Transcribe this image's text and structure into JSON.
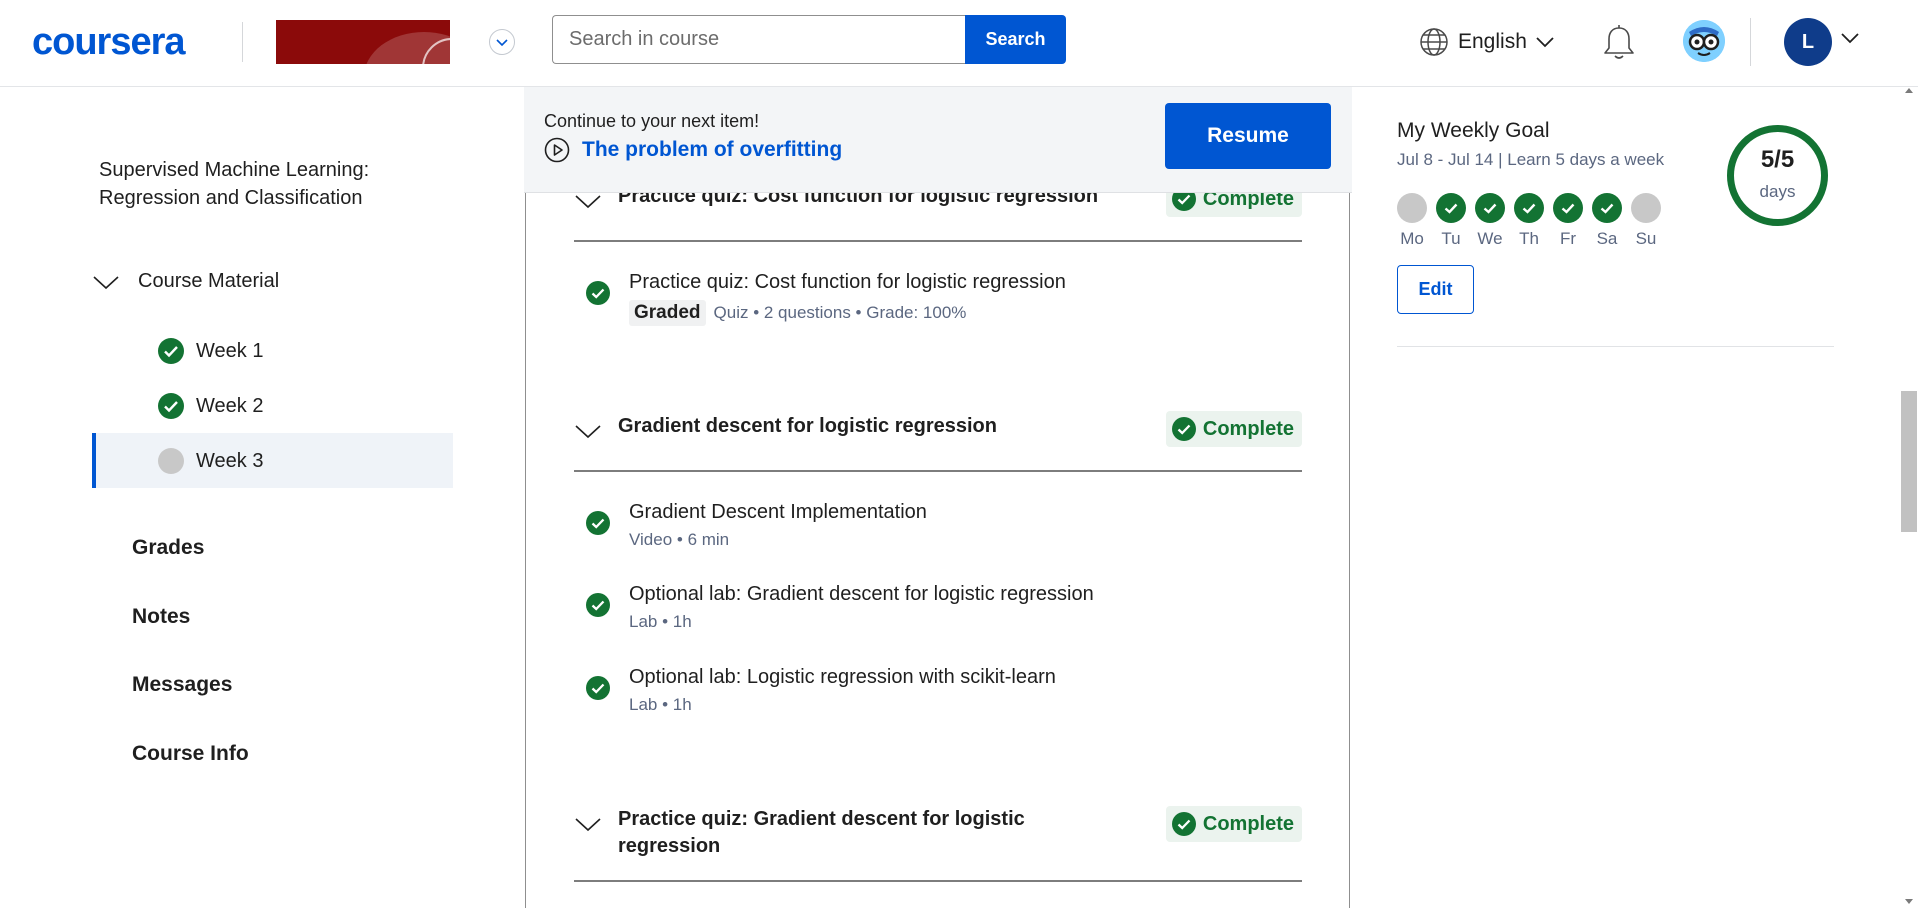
{
  "header": {
    "logo_text": "coursera",
    "search_placeholder": "Search in course",
    "search_button": "Search",
    "language": "English",
    "user_initial": "L"
  },
  "sidebar": {
    "course_title": "Supervised Machine Learning: Regression and Classification",
    "material_label": "Course Material",
    "weeks": [
      {
        "label": "Week 1",
        "status": "complete"
      },
      {
        "label": "Week 2",
        "status": "complete"
      },
      {
        "label": "Week 3",
        "status": "incomplete"
      }
    ],
    "links": [
      "Grades",
      "Notes",
      "Messages",
      "Course Info"
    ]
  },
  "continue": {
    "label": "Continue to your next item!",
    "item_title": "The problem of overfitting",
    "resume_button": "Resume"
  },
  "sections": [
    {
      "title": "Practice quiz: Cost function for logistic regression",
      "status": "Complete",
      "items": [
        {
          "title": "Practice quiz: Cost function for logistic regression",
          "tag": "Graded",
          "meta": "Quiz • 2 questions • Grade: 100%"
        }
      ]
    },
    {
      "title": "Gradient descent for logistic regression",
      "status": "Complete",
      "items": [
        {
          "title": "Gradient Descent Implementation",
          "meta": "Video • 6 min"
        },
        {
          "title": "Optional lab: Gradient descent for logistic regression",
          "meta": "Lab • 1h"
        },
        {
          "title": "Optional lab: Logistic regression with scikit-learn",
          "meta": "Lab • 1h"
        }
      ]
    },
    {
      "title_line1": "Practice quiz: Gradient descent for logistic",
      "title_line2": "regression",
      "status": "Complete"
    }
  ],
  "weekly_goal": {
    "title": "My Weekly Goal",
    "subtitle": "Jul 8 - Jul 14 | Learn 5 days a week",
    "days": [
      {
        "label": "Mo",
        "done": false
      },
      {
        "label": "Tu",
        "done": true
      },
      {
        "label": "We",
        "done": true
      },
      {
        "label": "Th",
        "done": true
      },
      {
        "label": "Fr",
        "done": true
      },
      {
        "label": "Sa",
        "done": true
      },
      {
        "label": "Su",
        "done": false
      }
    ],
    "progress_text": "5/5",
    "progress_unit": "days",
    "progress_fraction": 1.0,
    "edit_button": "Edit"
  },
  "colors": {
    "brand": "#0056d2",
    "complete_green": "#137333",
    "badge_bg": "#ebf3ee"
  }
}
